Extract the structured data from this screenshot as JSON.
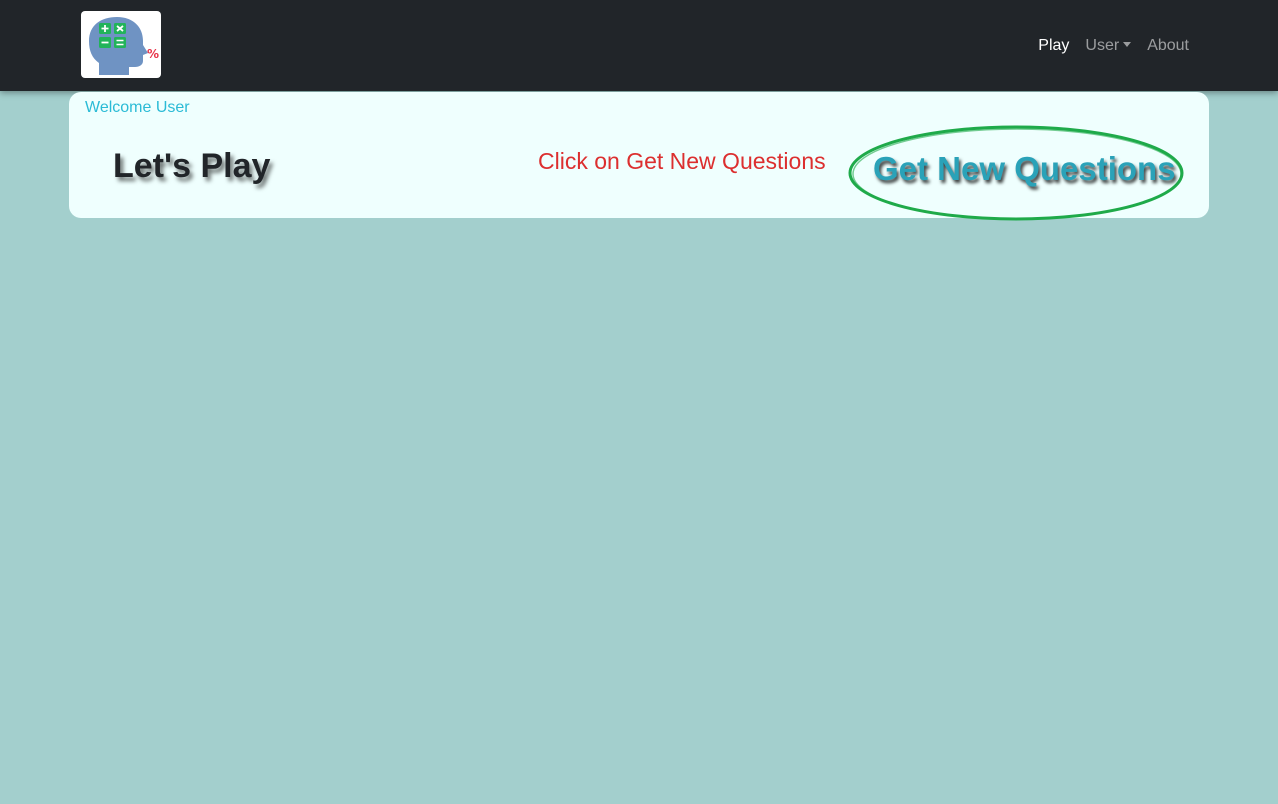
{
  "navbar": {
    "logo": {
      "icon": "head-with-math-symbols-icon",
      "symbol": "%"
    },
    "links": {
      "play": "Play",
      "user": "User",
      "about": "About"
    }
  },
  "card": {
    "welcome": "Welcome User",
    "title": "Let's Play",
    "hint": "Click on Get New Questions",
    "button_label": "Get New Questions"
  },
  "colors": {
    "navbar_bg": "#212529",
    "page_bg": "#a3cfcd",
    "card_bg": "#effffe",
    "welcome_text": "#2bbbd6",
    "hint_text": "#dc2f2f",
    "button_text": "#2aa2b8",
    "highlight_ring": "#1faa4a",
    "logo_head": "#6f93c3",
    "logo_blocks": "#22b35a",
    "logo_percent": "#e8344a"
  }
}
